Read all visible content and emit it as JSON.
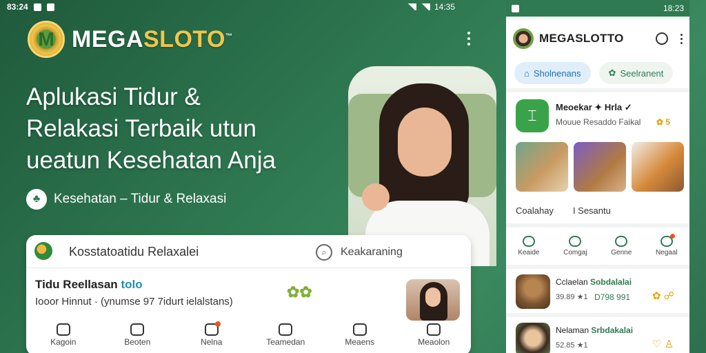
{
  "status_bar": {
    "time": "83:24",
    "battery": "14:35"
  },
  "brand": {
    "logo_letter": "M",
    "name_part1": "MEGA",
    "name_part2": "SLOTO",
    "tm": "™"
  },
  "hero": {
    "headline_line1": "Aplukasi Tidur &",
    "headline_line2": "Relakasi Terbaik utun",
    "headline_line3": "ueatun Kesehatan Anja",
    "subline": "Kesehatan – Tidur & Relaxasi"
  },
  "card": {
    "title": "Kosstatoatidu Relaxalei",
    "search_label": "Keakaraning",
    "item_title": "Tidu Reellasan",
    "item_title_accent": "tolo",
    "item_meta": "Iooor Hinnut · (ynumse 97 7idurt ielalstans)",
    "item_badge": "✿✿",
    "nav": [
      {
        "label": "Kagoin",
        "icon": "home-icon"
      },
      {
        "label": "Beoten",
        "icon": "calendar-icon"
      },
      {
        "label": "Nelna",
        "icon": "inbox-icon"
      },
      {
        "label": "Teamedan",
        "icon": "heart-icon"
      },
      {
        "label": "Meaens",
        "icon": "sound-icon"
      },
      {
        "label": "Meaolon",
        "icon": "profile-icon"
      }
    ]
  },
  "phone": {
    "status_time": "18:23",
    "brand": "MEGASLOTTO",
    "tabs": [
      {
        "label": "Sholnenans"
      },
      {
        "label": "Seelranent"
      }
    ],
    "app": {
      "name": "Meoekar ✦ Hrla ✓",
      "sub": "Mouue Resaddo Faikal",
      "rating": "✿ 5",
      "cat1": "Coalahay",
      "cat2": "I Sesantu"
    },
    "quick": [
      {
        "label": "Keaide"
      },
      {
        "label": "Comgaj"
      },
      {
        "label": "Genne"
      },
      {
        "label": "Negaal"
      }
    ],
    "list": [
      {
        "title": "Cclaelan",
        "tag": "Sobdalalai",
        "sub": "39.89",
        "num": "D798 991",
        "rating": "★1"
      },
      {
        "title": "Nelaman",
        "tag": "Srbdakalai",
        "sub": "52.85",
        "num": "",
        "rating": "★1"
      }
    ]
  },
  "colors": {
    "accent": "#2f7a52",
    "gold": "#f1c64a",
    "background": "#2f7a52"
  }
}
